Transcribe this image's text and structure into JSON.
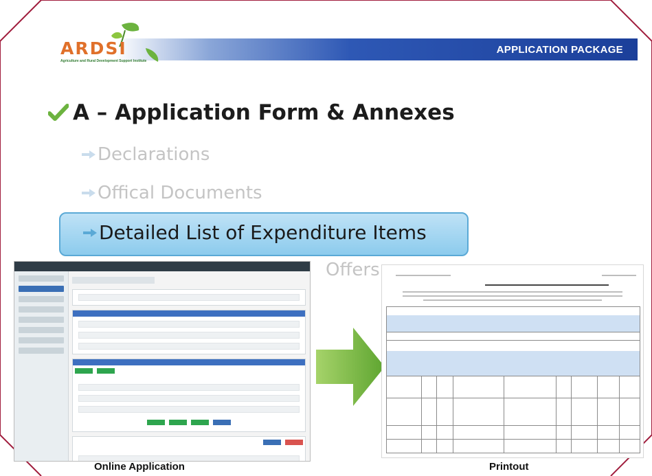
{
  "header": {
    "title": "APPLICATION PACKAGE",
    "logo_text": "ARDSI",
    "logo_subtitle": "Agriculture and Rural Development Support Institute"
  },
  "section": {
    "heading": "A – Application Form & Annexes",
    "items": [
      {
        "label": "Declarations",
        "state": "dimmed"
      },
      {
        "label": "Offical Documents",
        "state": "dimmed"
      },
      {
        "label": "Detailed List of Expenditure Items",
        "state": "highlighted"
      },
      {
        "label": "Offers",
        "state": "dimmed"
      }
    ]
  },
  "captions": {
    "online": "Online Application",
    "printout": "Printout"
  },
  "colors": {
    "header_blue": "#1b3f9a",
    "highlight_fill": "#8ccbed",
    "arrow_green": "#6cb33f",
    "frame_red": "#a01c3c"
  }
}
